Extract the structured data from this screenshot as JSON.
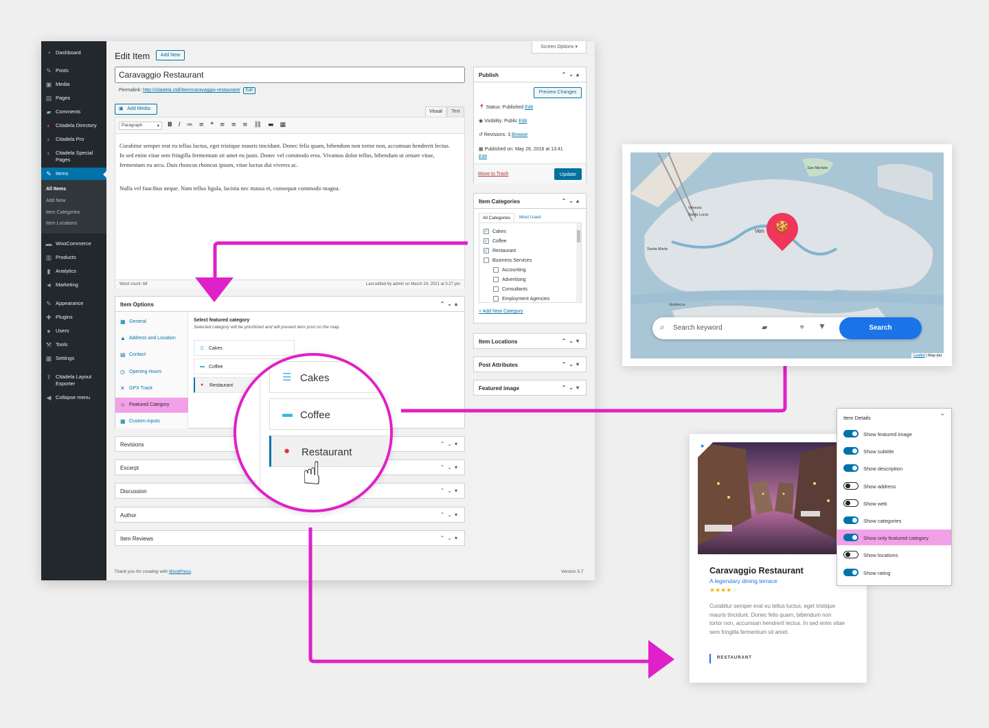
{
  "sidebar": {
    "items": [
      {
        "label": "Dashboard",
        "icon": "dashboard-icon"
      },
      {
        "label": "Posts",
        "icon": "pin-icon"
      },
      {
        "label": "Media",
        "icon": "media-icon"
      },
      {
        "label": "Pages",
        "icon": "pages-icon"
      },
      {
        "label": "Comments",
        "icon": "comments-icon"
      },
      {
        "label": "Citadela Directory",
        "icon": "citadela-icon"
      },
      {
        "label": "Citadela Pro",
        "icon": "citadela-icon"
      },
      {
        "label": "Citadela Special Pages",
        "icon": "citadela-icon"
      },
      {
        "label": "Items",
        "icon": "pin-icon"
      },
      {
        "label": "WooCommerce",
        "icon": "woo-icon"
      },
      {
        "label": "Products",
        "icon": "products-icon"
      },
      {
        "label": "Analytics",
        "icon": "analytics-icon"
      },
      {
        "label": "Marketing",
        "icon": "megaphone-icon"
      },
      {
        "label": "Appearance",
        "icon": "brush-icon"
      },
      {
        "label": "Plugins",
        "icon": "plugin-icon"
      },
      {
        "label": "Users",
        "icon": "user-icon"
      },
      {
        "label": "Tools",
        "icon": "wrench-icon"
      },
      {
        "label": "Settings",
        "icon": "settings-icon"
      },
      {
        "label": "Citadela Layout Exporter",
        "icon": "export-icon"
      },
      {
        "label": "Collapse menu",
        "icon": "collapse-icon"
      }
    ],
    "submenu": [
      "All Items",
      "Add New",
      "Item Categories",
      "Item Locations"
    ]
  },
  "header": {
    "title": "Edit Item",
    "add_new": "Add New",
    "screen_options": "Screen Options ▾"
  },
  "editor": {
    "post_title": "Caravaggio Restaurant",
    "permalink_label": "Permalink:",
    "permalink_url": "http://citadela.ctdl/item/caravaggio-restaurant/",
    "permalink_edit": "Edit",
    "add_media": "Add Media",
    "tab_visual": "Visual",
    "tab_text": "Text",
    "format_select": "Paragraph",
    "paragraph1": "Curabitur semper erat eu tellus luctus, eget tristique mauris tincidunt. Donec felis quam, bibendum non tortor non, accumsan hendrerit lectus. In sed enim vitae sem fringilla fermentum sit amet eu justo. Donec vel commodo eros. Vivamus dolor tellus, bibendum ut ornare vitae, fermentum eu arcu. Duis rhoncus rhoncus ipsum, vitae luctus dui viverra ac.",
    "paragraph2": "Nulla vel faucibus neque. Nam tellus ligula, lacinia nec massa et, consequat commodo magna.",
    "word_count": "Word count: 68",
    "last_edited": "Last edited by admin on March 24, 2021 at 5:27 pm"
  },
  "item_options": {
    "title": "Item Options",
    "tabs": [
      "General",
      "Address and Location",
      "Contact",
      "Opening Hours",
      "GPX Track",
      "Featured Category",
      "Custom inputs"
    ],
    "select_heading": "Select featured category",
    "select_desc": "Selected category will be prioritized and will present item post on the map.",
    "options": [
      "Cakes",
      "Coffee",
      "Restaurant"
    ]
  },
  "collapsed_boxes": [
    "Revisions",
    "Excerpt",
    "Discussion",
    "Author",
    "Item Reviews"
  ],
  "footer": {
    "thanks": "Thank you for creating with",
    "wp_link": "WordPress",
    "version": "Version 5.7"
  },
  "publish": {
    "title": "Publish",
    "preview": "Preview Changes",
    "status_label": "Status:",
    "status_value": "Published",
    "visibility_label": "Visibility:",
    "visibility_value": "Public",
    "revisions_label": "Revisions:",
    "revisions_value": "3",
    "browse": "Browse",
    "published_label": "Published on:",
    "published_value": "May 26, 2016 at 13:41",
    "edit": "Edit",
    "trash": "Move to Trash",
    "update": "Update"
  },
  "categories": {
    "title": "Item Categories",
    "tab_all": "All Categories",
    "tab_used": "Most Used",
    "list": [
      {
        "label": "Cakes",
        "checked": true,
        "indent": false
      },
      {
        "label": "Coffee",
        "checked": true,
        "indent": false
      },
      {
        "label": "Restaurant",
        "checked": true,
        "indent": false
      },
      {
        "label": "Business Services",
        "checked": false,
        "indent": false
      },
      {
        "label": "Accounting",
        "checked": false,
        "indent": true
      },
      {
        "label": "Advertising",
        "checked": false,
        "indent": true
      },
      {
        "label": "Consultants",
        "checked": false,
        "indent": true
      },
      {
        "label": "Employment Agencies",
        "checked": false,
        "indent": true
      }
    ],
    "add_new": "+ Add New Category"
  },
  "side_boxes": [
    "Item Locations",
    "Post Attributes",
    "Featured image"
  ],
  "zoom": {
    "options": [
      "Cakes",
      "Coffee",
      "Restaurant"
    ]
  },
  "map": {
    "labels": [
      "San Michele",
      "Venezia",
      "Santa Lucia",
      "Santa Marta",
      "Giudecca",
      "Ven"
    ],
    "search_placeholder": "Search keyword",
    "search_button": "Search",
    "attribution_leaflet": "Leaflet",
    "attribution_map": "| Map dat"
  },
  "listing": {
    "title": "Caravaggio Restaurant",
    "subtitle": "A legendary dining terrace",
    "rating": 4,
    "description": "Curabitur semper erat eu tellus luctus, eget tristique mauris tincidunt. Donec felis quam, bibendum non tortor non, accumsan hendrerit lectus. In sed enim vitae sem fringilla fermentum sit amet.",
    "category": "RESTAURANT"
  },
  "item_details": {
    "title": "Item Details",
    "toggles": [
      {
        "label": "Show featured image",
        "on": true
      },
      {
        "label": "Show subtitle",
        "on": true
      },
      {
        "label": "Show description",
        "on": true
      },
      {
        "label": "Show address",
        "on": false
      },
      {
        "label": "Show web",
        "on": false
      },
      {
        "label": "Show categories",
        "on": true
      },
      {
        "label": "Show only featured category",
        "on": true
      },
      {
        "label": "Show locations",
        "on": false
      },
      {
        "label": "Show rating",
        "on": true
      }
    ]
  },
  "colors": {
    "accent": "#e020c8",
    "wp_blue": "#0073aa",
    "sidebar": "#23282d",
    "marker": "#f0365a",
    "search_btn": "#1a73e8"
  }
}
